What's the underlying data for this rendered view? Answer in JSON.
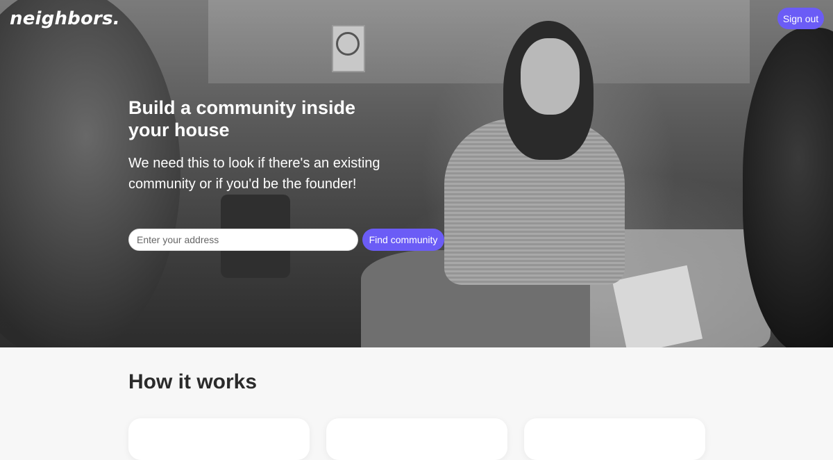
{
  "header": {
    "logo": "neighbors.",
    "signout_label": "Sign out"
  },
  "hero": {
    "headline": "Build a community inside your house",
    "subline": "We need this to look if there's an existing community or if you'd be the founder!",
    "address_placeholder": "Enter your address",
    "address_value": "",
    "find_label": "Find community"
  },
  "how": {
    "title": "How it works"
  },
  "colors": {
    "accent": "#6b5cf6",
    "section_bg": "#f7f7f7",
    "card_bg": "#ffffff"
  }
}
